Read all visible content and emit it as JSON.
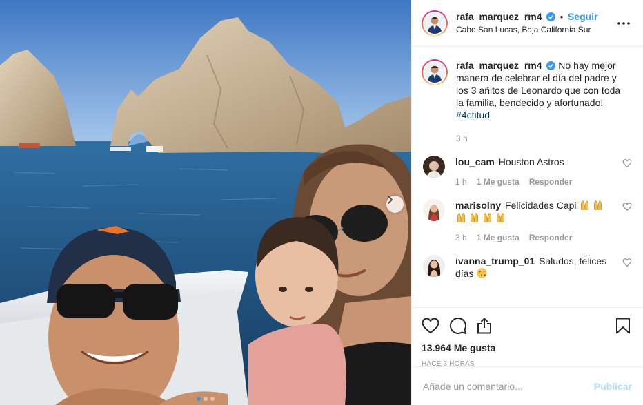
{
  "header": {
    "username": "rafa_marquez_rm4",
    "separator": "•",
    "follow_label": "Seguir",
    "location": "Cabo San Lucas, Baja California Sur"
  },
  "caption": {
    "username": "rafa_marquez_rm4",
    "text": "No hay mejor manera de celebrar el día del padre y los 3 añitos de Leonardo que con toda la familia, bendecido y afortunado!",
    "hashtag": "#4ctitud",
    "time": "3 h"
  },
  "comments": [
    {
      "username": "lou_cam",
      "text": "Houston Astros",
      "time": "1 h",
      "likes": "1 Me gusta",
      "reply": "Responder"
    },
    {
      "username": "marisolny",
      "text": "Felicidades Capi",
      "time": "3 h",
      "likes": "1 Me gusta",
      "reply": "Responder"
    },
    {
      "username": "ivanna_trump_01",
      "text": "Saludos, felices días",
      "time": "",
      "likes": "",
      "reply": ""
    }
  ],
  "actions": {
    "likes": "13.964 Me gusta",
    "ago": "HACE 3 HORAS"
  },
  "composer": {
    "placeholder": "Añade un comentario...",
    "publish_label": "Publicar"
  },
  "carousel": {
    "dots": 3,
    "active": 1
  },
  "colors": {
    "link": "#3897f0",
    "verified": "#3897f0",
    "hashtag": "#003569",
    "muted": "#999999",
    "carousel_active": "#2b9af3"
  },
  "icons": [
    "verified-icon",
    "more-options-icon",
    "heart-icon",
    "comment-icon",
    "share-icon",
    "bookmark-icon",
    "chevron-right-icon"
  ]
}
